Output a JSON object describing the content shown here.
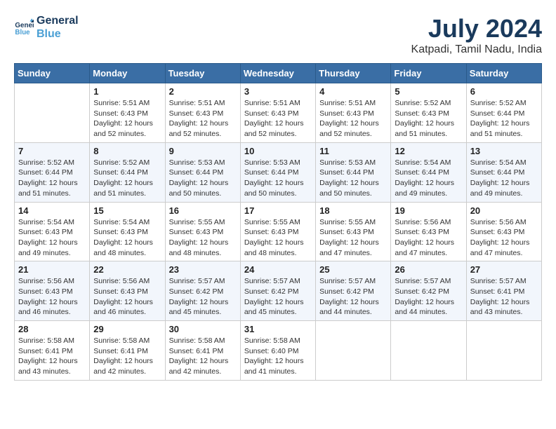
{
  "logo": {
    "line1": "General",
    "line2": "Blue"
  },
  "title": "July 2024",
  "location": "Katpadi, Tamil Nadu, India",
  "headers": [
    "Sunday",
    "Monday",
    "Tuesday",
    "Wednesday",
    "Thursday",
    "Friday",
    "Saturday"
  ],
  "weeks": [
    [
      {
        "day": "",
        "info": ""
      },
      {
        "day": "1",
        "info": "Sunrise: 5:51 AM\nSunset: 6:43 PM\nDaylight: 12 hours\nand 52 minutes."
      },
      {
        "day": "2",
        "info": "Sunrise: 5:51 AM\nSunset: 6:43 PM\nDaylight: 12 hours\nand 52 minutes."
      },
      {
        "day": "3",
        "info": "Sunrise: 5:51 AM\nSunset: 6:43 PM\nDaylight: 12 hours\nand 52 minutes."
      },
      {
        "day": "4",
        "info": "Sunrise: 5:51 AM\nSunset: 6:43 PM\nDaylight: 12 hours\nand 52 minutes."
      },
      {
        "day": "5",
        "info": "Sunrise: 5:52 AM\nSunset: 6:43 PM\nDaylight: 12 hours\nand 51 minutes."
      },
      {
        "day": "6",
        "info": "Sunrise: 5:52 AM\nSunset: 6:44 PM\nDaylight: 12 hours\nand 51 minutes."
      }
    ],
    [
      {
        "day": "7",
        "info": "Sunrise: 5:52 AM\nSunset: 6:44 PM\nDaylight: 12 hours\nand 51 minutes."
      },
      {
        "day": "8",
        "info": "Sunrise: 5:52 AM\nSunset: 6:44 PM\nDaylight: 12 hours\nand 51 minutes."
      },
      {
        "day": "9",
        "info": "Sunrise: 5:53 AM\nSunset: 6:44 PM\nDaylight: 12 hours\nand 50 minutes."
      },
      {
        "day": "10",
        "info": "Sunrise: 5:53 AM\nSunset: 6:44 PM\nDaylight: 12 hours\nand 50 minutes."
      },
      {
        "day": "11",
        "info": "Sunrise: 5:53 AM\nSunset: 6:44 PM\nDaylight: 12 hours\nand 50 minutes."
      },
      {
        "day": "12",
        "info": "Sunrise: 5:54 AM\nSunset: 6:44 PM\nDaylight: 12 hours\nand 49 minutes."
      },
      {
        "day": "13",
        "info": "Sunrise: 5:54 AM\nSunset: 6:44 PM\nDaylight: 12 hours\nand 49 minutes."
      }
    ],
    [
      {
        "day": "14",
        "info": "Sunrise: 5:54 AM\nSunset: 6:43 PM\nDaylight: 12 hours\nand 49 minutes."
      },
      {
        "day": "15",
        "info": "Sunrise: 5:54 AM\nSunset: 6:43 PM\nDaylight: 12 hours\nand 48 minutes."
      },
      {
        "day": "16",
        "info": "Sunrise: 5:55 AM\nSunset: 6:43 PM\nDaylight: 12 hours\nand 48 minutes."
      },
      {
        "day": "17",
        "info": "Sunrise: 5:55 AM\nSunset: 6:43 PM\nDaylight: 12 hours\nand 48 minutes."
      },
      {
        "day": "18",
        "info": "Sunrise: 5:55 AM\nSunset: 6:43 PM\nDaylight: 12 hours\nand 47 minutes."
      },
      {
        "day": "19",
        "info": "Sunrise: 5:56 AM\nSunset: 6:43 PM\nDaylight: 12 hours\nand 47 minutes."
      },
      {
        "day": "20",
        "info": "Sunrise: 5:56 AM\nSunset: 6:43 PM\nDaylight: 12 hours\nand 47 minutes."
      }
    ],
    [
      {
        "day": "21",
        "info": "Sunrise: 5:56 AM\nSunset: 6:43 PM\nDaylight: 12 hours\nand 46 minutes."
      },
      {
        "day": "22",
        "info": "Sunrise: 5:56 AM\nSunset: 6:43 PM\nDaylight: 12 hours\nand 46 minutes."
      },
      {
        "day": "23",
        "info": "Sunrise: 5:57 AM\nSunset: 6:42 PM\nDaylight: 12 hours\nand 45 minutes."
      },
      {
        "day": "24",
        "info": "Sunrise: 5:57 AM\nSunset: 6:42 PM\nDaylight: 12 hours\nand 45 minutes."
      },
      {
        "day": "25",
        "info": "Sunrise: 5:57 AM\nSunset: 6:42 PM\nDaylight: 12 hours\nand 44 minutes."
      },
      {
        "day": "26",
        "info": "Sunrise: 5:57 AM\nSunset: 6:42 PM\nDaylight: 12 hours\nand 44 minutes."
      },
      {
        "day": "27",
        "info": "Sunrise: 5:57 AM\nSunset: 6:41 PM\nDaylight: 12 hours\nand 43 minutes."
      }
    ],
    [
      {
        "day": "28",
        "info": "Sunrise: 5:58 AM\nSunset: 6:41 PM\nDaylight: 12 hours\nand 43 minutes."
      },
      {
        "day": "29",
        "info": "Sunrise: 5:58 AM\nSunset: 6:41 PM\nDaylight: 12 hours\nand 42 minutes."
      },
      {
        "day": "30",
        "info": "Sunrise: 5:58 AM\nSunset: 6:41 PM\nDaylight: 12 hours\nand 42 minutes."
      },
      {
        "day": "31",
        "info": "Sunrise: 5:58 AM\nSunset: 6:40 PM\nDaylight: 12 hours\nand 41 minutes."
      },
      {
        "day": "",
        "info": ""
      },
      {
        "day": "",
        "info": ""
      },
      {
        "day": "",
        "info": ""
      }
    ]
  ]
}
